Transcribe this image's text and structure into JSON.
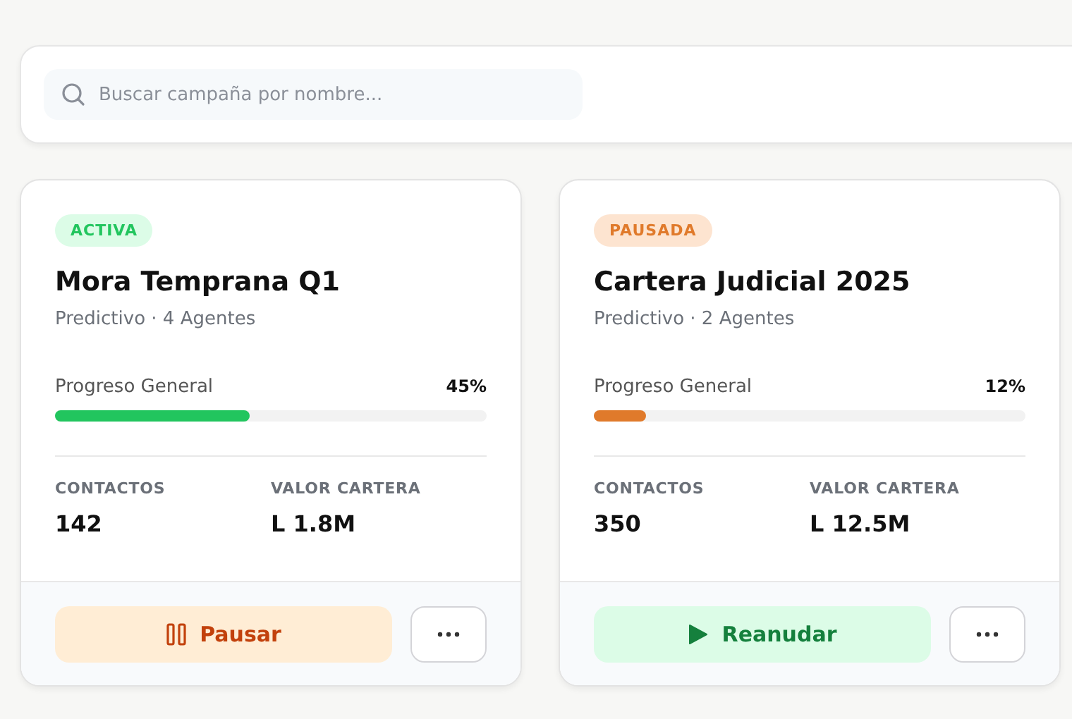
{
  "search": {
    "placeholder": "Buscar campaña por nombre..."
  },
  "campaigns": [
    {
      "kind": "active",
      "badge": "ACTIVA",
      "name": "Mora Temprana Q1",
      "subtitle": "Predictivo · 4 Agentes",
      "progress_label": "Progreso General",
      "progress_text": "45%",
      "level": 0.45,
      "stats": [
        {
          "label": "CONTACTOS",
          "value": "142"
        },
        {
          "label": "VALOR CARTERA",
          "value": "L 1.8M"
        }
      ],
      "action": {
        "kind": "pause",
        "label": "Pausar"
      }
    },
    {
      "kind": "paused",
      "badge": "PAUSADA",
      "name": "Cartera Judicial 2025",
      "subtitle": "Predictivo · 2 Agentes",
      "progress_label": "Progreso General",
      "progress_text": "12%",
      "level": 0.12,
      "stats": [
        {
          "label": "CONTACTOS",
          "value": "350"
        },
        {
          "label": "VALOR CARTERA",
          "value": "L 12.5M"
        }
      ],
      "action": {
        "kind": "resume",
        "label": "Reanudar"
      }
    }
  ]
}
